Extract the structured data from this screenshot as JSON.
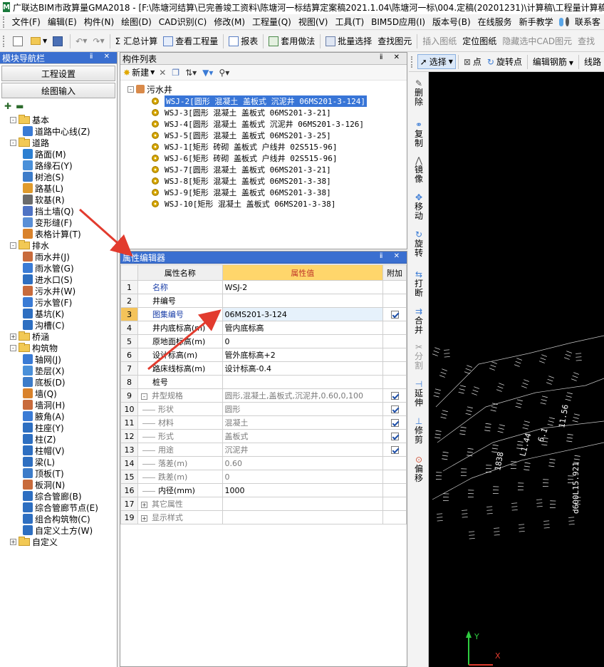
{
  "title": "广联达BIM市政算量GMA2018 - [F:\\陈塘河结算\\已完善竣工资料\\陈塘河一标结算定案稿2021.1.04\\陈塘河一标\\004.定稿(20201231)\\计算稿\\工程量计算稿",
  "app_logo": "M",
  "menu": [
    "文件(F)",
    "编辑(E)",
    "构件(N)",
    "绘图(D)",
    "CAD识别(C)",
    "修改(M)",
    "工程量(Q)",
    "视图(V)",
    "工具(T)",
    "BIM5D应用(I)",
    "版本号(B)",
    "在线服务",
    "新手教学",
    "联系客"
  ],
  "toolbar": {
    "sum": "汇总计算",
    "view_qty": "查看工程量",
    "report": "报表",
    "apply_method": "套用做法",
    "batch_select": "批量选择",
    "query_shape": "查找图元",
    "insert_drawing": "插入图纸",
    "locate_drawing": "定位图纸",
    "hide_cad": "隐藏选中CAD图元",
    "query": "查找"
  },
  "left_panel": {
    "title": "模块导航栏",
    "btn_project": "工程设置",
    "btn_draw": "绘图输入",
    "tree": [
      {
        "t": "folder",
        "label": "基本",
        "lvl": 0,
        "exp": "-"
      },
      {
        "t": "item",
        "label": "道路中心线(Z)",
        "lvl": 1,
        "color": "#3a7bd5"
      },
      {
        "t": "folder",
        "label": "道路",
        "lvl": 0,
        "exp": "-"
      },
      {
        "t": "item",
        "label": "路面(M)",
        "lvl": 1,
        "color": "#2c7fd1"
      },
      {
        "t": "item",
        "label": "路缘石(Y)",
        "lvl": 1,
        "color": "#4a90d9"
      },
      {
        "t": "item",
        "label": "树池(S)",
        "lvl": 1,
        "color": "#3d7cc9"
      },
      {
        "t": "item",
        "label": "路基(L)",
        "lvl": 1,
        "color": "#e09b2d"
      },
      {
        "t": "item",
        "label": "软基(R)",
        "lvl": 1,
        "color": "#6b6b6b"
      },
      {
        "t": "item",
        "label": "挡土墙(Q)",
        "lvl": 1,
        "color": "#4f73c4"
      },
      {
        "t": "item",
        "label": "变形缝(F)",
        "lvl": 1,
        "color": "#5a8fd6"
      },
      {
        "t": "item",
        "label": "表格计算(T)",
        "lvl": 1,
        "color": "#d9822b"
      },
      {
        "t": "folder",
        "label": "排水",
        "lvl": 0,
        "exp": "-"
      },
      {
        "t": "item",
        "label": "雨水井(J)",
        "lvl": 1,
        "color": "#c86b3c"
      },
      {
        "t": "item",
        "label": "雨水管(G)",
        "lvl": 1,
        "color": "#3a7bd5"
      },
      {
        "t": "item",
        "label": "进水口(S)",
        "lvl": 1,
        "color": "#2e6fc1"
      },
      {
        "t": "item",
        "label": "污水井(W)",
        "lvl": 1,
        "color": "#c86b3c"
      },
      {
        "t": "item",
        "label": "污水管(F)",
        "lvl": 1,
        "color": "#3a7bd5"
      },
      {
        "t": "item",
        "label": "基坑(K)",
        "lvl": 1,
        "color": "#2e6fc1"
      },
      {
        "t": "item",
        "label": "沟槽(C)",
        "lvl": 1,
        "color": "#2e6fc1"
      },
      {
        "t": "folder",
        "label": "桥涵",
        "lvl": 0,
        "exp": "+"
      },
      {
        "t": "folder",
        "label": "构筑物",
        "lvl": 0,
        "exp": "-"
      },
      {
        "t": "item",
        "label": "轴网(J)",
        "lvl": 1,
        "color": "#3a7bd5"
      },
      {
        "t": "item",
        "label": "垫层(X)",
        "lvl": 1,
        "color": "#4a90d9"
      },
      {
        "t": "item",
        "label": "底板(D)",
        "lvl": 1,
        "color": "#3d7cc9"
      },
      {
        "t": "item",
        "label": "墙(Q)",
        "lvl": 1,
        "color": "#d9822b"
      },
      {
        "t": "item",
        "label": "墙洞(H)",
        "lvl": 1,
        "color": "#c86b3c"
      },
      {
        "t": "item",
        "label": "腋角(A)",
        "lvl": 1,
        "color": "#3a7bd5"
      },
      {
        "t": "item",
        "label": "柱座(Y)",
        "lvl": 1,
        "color": "#2e6fc1"
      },
      {
        "t": "item",
        "label": "柱(Z)",
        "lvl": 1,
        "color": "#2e6fc1"
      },
      {
        "t": "item",
        "label": "柱帽(V)",
        "lvl": 1,
        "color": "#2e6fc1"
      },
      {
        "t": "item",
        "label": "梁(L)",
        "lvl": 1,
        "color": "#2e6fc1"
      },
      {
        "t": "item",
        "label": "顶板(T)",
        "lvl": 1,
        "color": "#3d7cc9"
      },
      {
        "t": "item",
        "label": "板洞(N)",
        "lvl": 1,
        "color": "#c86b3c"
      },
      {
        "t": "item",
        "label": "综合管廊(B)",
        "lvl": 1,
        "color": "#2e6fc1"
      },
      {
        "t": "item",
        "label": "综合管廊节点(E)",
        "lvl": 1,
        "color": "#2e6fc1"
      },
      {
        "t": "item",
        "label": "组合构筑物(C)",
        "lvl": 1,
        "color": "#2e6fc1"
      },
      {
        "t": "item",
        "label": "自定义土方(W)",
        "lvl": 1,
        "color": "#2e6fc1"
      },
      {
        "t": "folder",
        "label": "自定义",
        "lvl": 0,
        "exp": "+"
      }
    ]
  },
  "component_list": {
    "title": "构件列表",
    "new_btn": "新建",
    "root": "污水井",
    "items": [
      "WSJ-2[圆形 混凝土 盖板式 沉泥井 06MS201-3-124]",
      "WSJ-3[圆形 混凝土 盖板式  06MS201-3-21]",
      "WSJ-4[圆形 混凝土 盖板式 沉泥井 06MS201-3-126]",
      "WSJ-5[圆形 混凝土 盖板式  06MS201-3-25]",
      "WSJ-1[矩形 砖砌 盖板式 户线井 02S515-96]",
      "WSJ-6[矩形 砖砌 盖板式 户线井 02S515-96]",
      "WSJ-7[圆形 混凝土 盖板式  06MS201-3-21]",
      "WSJ-8[矩形 混凝土 盖板式  06MS201-3-38]",
      "WSJ-9[矩形 混凝土 盖板式  06MS201-3-38]",
      "WSJ-10[矩形 混凝土 盖板式  06MS201-3-38]"
    ]
  },
  "prop_editor": {
    "title": "属性编辑器",
    "col_name": "属性名称",
    "col_value": "属性值",
    "col_extra": "附加",
    "rows": [
      {
        "n": "1",
        "name": "名称",
        "value": "WSJ-2",
        "chk": "",
        "style": "blue",
        "exp": ""
      },
      {
        "n": "2",
        "name": "井编号",
        "value": "",
        "chk": "",
        "style": "",
        "exp": ""
      },
      {
        "n": "3",
        "name": "图集编号",
        "value": "06MS201-3-124",
        "chk": "on",
        "style": "blue",
        "exp": "",
        "sel": true
      },
      {
        "n": "4",
        "name": "井内底标高(m)",
        "value": "管内底标高",
        "chk": "",
        "style": "",
        "exp": ""
      },
      {
        "n": "5",
        "name": "原地面标高(m)",
        "value": "0",
        "chk": "",
        "style": "",
        "exp": ""
      },
      {
        "n": "6",
        "name": "设计标高(m)",
        "value": "管外底标高+2",
        "chk": "",
        "style": "",
        "exp": ""
      },
      {
        "n": "7",
        "name": "路床线标高(m)",
        "value": "设计标高-0.4",
        "chk": "",
        "style": "",
        "exp": ""
      },
      {
        "n": "8",
        "name": "桩号",
        "value": "",
        "chk": "",
        "style": "",
        "exp": ""
      },
      {
        "n": "9",
        "name": "井型规格",
        "value": "圆形,混凝土,盖板式,沉泥井,0.60,0,100",
        "chk": "on",
        "style": "grayv",
        "exp": "-"
      },
      {
        "n": "10",
        "name": "形状",
        "value": "圆形",
        "chk": "on",
        "style": "sub",
        "exp": ""
      },
      {
        "n": "11",
        "name": "材料",
        "value": "混凝土",
        "chk": "on",
        "style": "sub",
        "exp": ""
      },
      {
        "n": "12",
        "name": "形式",
        "value": "盖板式",
        "chk": "on",
        "style": "sub",
        "exp": ""
      },
      {
        "n": "13",
        "name": "用途",
        "value": "沉泥井",
        "chk": "on",
        "style": "sub",
        "exp": ""
      },
      {
        "n": "14",
        "name": "落差(m)",
        "value": "0.60",
        "chk": "",
        "style": "sub",
        "exp": ""
      },
      {
        "n": "15",
        "name": "跌差(m)",
        "value": "0",
        "chk": "",
        "style": "sub",
        "exp": ""
      },
      {
        "n": "16",
        "name": "内径(mm)",
        "value": "1000",
        "chk": "",
        "style": "subdark",
        "exp": ""
      },
      {
        "n": "17",
        "name": "其它属性",
        "value": "",
        "chk": "",
        "style": "grp",
        "exp": "+"
      },
      {
        "n": "19",
        "name": "显示样式",
        "value": "",
        "chk": "",
        "style": "grp",
        "exp": "+"
      }
    ]
  },
  "right_toolbar": {
    "select": "选择",
    "point": "点",
    "rotate_point": "旋转点",
    "edit_rebar": "编辑钢筋",
    "line": "线路"
  },
  "vertical_tools": [
    "删除",
    "复制",
    "镜像",
    "移动",
    "旋转",
    "打断",
    "合并",
    "分割",
    "延伸",
    "修剪",
    "偏移"
  ],
  "canvas_labels": [
    "d600L15.921",
    "1838",
    "L1.44",
    "6.1",
    "11.56"
  ],
  "axis": {
    "y": "Y",
    "x": "X"
  },
  "colors": {
    "accent": "#3a6fd0",
    "highlight_header": "#ffd66b",
    "arrow": "#e23b2e"
  }
}
